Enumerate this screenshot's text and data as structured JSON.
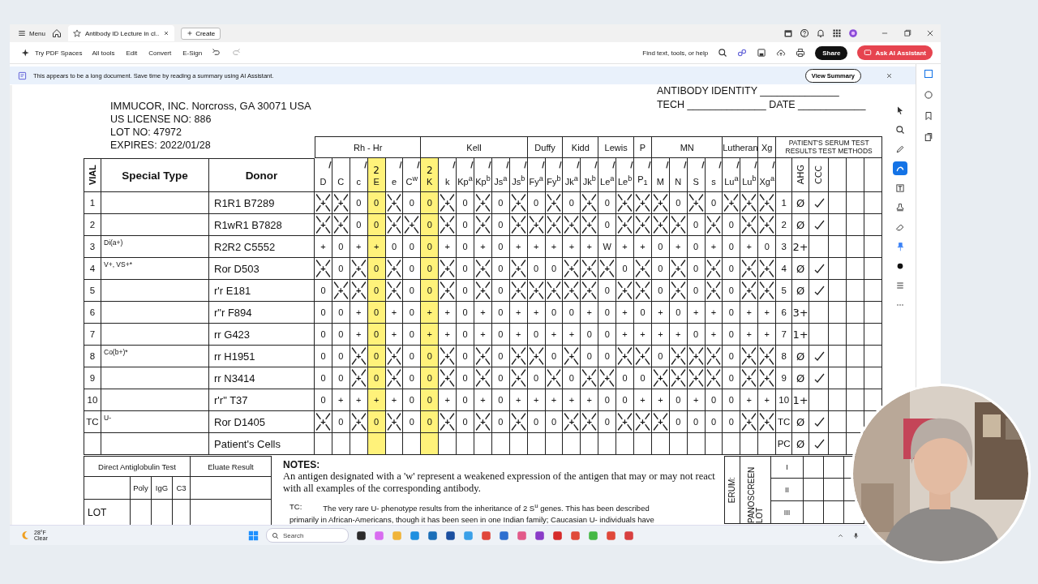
{
  "browser": {
    "menu": "Menu",
    "tabs": [
      {
        "title": "Antibody ID Lecture in cl..",
        "selected": true
      }
    ],
    "create": "Create"
  },
  "toolbar": {
    "spaces": "Try PDF Spaces",
    "menus": [
      "All tools",
      "Edit",
      "Convert",
      "E-Sign"
    ],
    "search": "Find text, tools, or help",
    "share": "Share",
    "ai": "Ask AI Assistant"
  },
  "banner": {
    "text": "This appears to be a long document. Save time by reading a summary using AI Assistant.",
    "button": "View Summary"
  },
  "tools": [
    {
      "kind": "select",
      "selected": false
    },
    {
      "kind": "zoom",
      "selected": false
    },
    {
      "kind": "pen",
      "selected": false
    },
    {
      "kind": "highlight",
      "selected": true
    },
    {
      "kind": "text",
      "selected": false
    },
    {
      "kind": "stamp",
      "selected": false
    },
    {
      "kind": "eraser",
      "selected": false
    },
    {
      "kind": "pin",
      "selected": false
    },
    {
      "kind": "color",
      "selected": false
    },
    {
      "kind": "lines",
      "selected": false
    },
    {
      "kind": "more",
      "selected": false
    }
  ],
  "document": {
    "company": [
      "IMMUCOR, INC. Norcross, GA 30071  USA",
      "US LICENSE NO:   886",
      "LOT NO:    47972",
      "EXPIRES: 2022/01/28"
    ],
    "identity": [
      "ANTIBODY IDENTITY ______________",
      "TECH ______________ DATE ____________"
    ],
    "panel": {
      "left_headers": [
        "VIAL",
        "Special Type",
        "Donor"
      ],
      "result_header": "PATIENT'S SERUM TEST RESULTS TEST METHODS",
      "methods": [
        "AHG",
        "CCC"
      ],
      "groups": [
        {
          "label": "Rh - Hr",
          "columns": [
            {
              "label": "D",
              "crossed": true,
              "highlighted": false
            },
            {
              "label": "C",
              "crossed": false,
              "highlighted": false
            },
            {
              "label": "c",
              "crossed": true,
              "highlighted": false
            },
            {
              "label": "E",
              "crossed": false,
              "highlighted": true,
              "note": "2"
            },
            {
              "label": "e",
              "crossed": true,
              "highlighted": false
            },
            {
              "label": "C$^{w}$",
              "crossed": true,
              "highlighted": false
            }
          ]
        },
        {
          "label": "Kell",
          "columns": [
            {
              "label": "K",
              "crossed": false,
              "highlighted": true,
              "note": "2"
            },
            {
              "label": "k",
              "crossed": true,
              "highlighted": false
            },
            {
              "label": "Kp$^{a}$",
              "crossed": true,
              "highlighted": false
            },
            {
              "label": "Kp$^{b}$",
              "crossed": true,
              "highlighted": false
            },
            {
              "label": "Js$^{a}$",
              "crossed": true,
              "highlighted": false
            },
            {
              "label": "Js$^{b}$",
              "crossed": true,
              "highlighted": false
            }
          ]
        },
        {
          "label": "Duffy",
          "columns": [
            {
              "label": "Fy$^{a}$",
              "crossed": true,
              "highlighted": false
            },
            {
              "label": "Fy$^{b}$",
              "crossed": true,
              "highlighted": false
            }
          ]
        },
        {
          "label": "Kidd",
          "columns": [
            {
              "label": "Jk$^{a}$",
              "crossed": true,
              "highlighted": false
            },
            {
              "label": "Jk$^{b}$",
              "crossed": true,
              "highlighted": false
            }
          ]
        },
        {
          "label": "Lewis",
          "columns": [
            {
              "label": "Le$^{a}$",
              "crossed": true,
              "highlighted": false
            },
            {
              "label": "Le$^{b}$",
              "crossed": true,
              "highlighted": false
            }
          ]
        },
        {
          "label": "P",
          "columns": [
            {
              "label": "P$_{1}$",
              "crossed": true,
              "highlighted": false
            }
          ]
        },
        {
          "label": "MN",
          "columns": [
            {
              "label": "M",
              "crossed": true,
              "highlighted": false
            },
            {
              "label": "N",
              "crossed": true,
              "highlighted": false
            },
            {
              "label": "S",
              "crossed": true,
              "highlighted": false
            },
            {
              "label": "s",
              "crossed": true,
              "highlighted": false
            }
          ]
        },
        {
          "label": "Lutheran",
          "columns": [
            {
              "label": "Lu$^{a}$",
              "crossed": true,
              "highlighted": false
            },
            {
              "label": "Lu$^{b}$",
              "crossed": true,
              "highlighted": false
            }
          ]
        },
        {
          "label": "Xg",
          "columns": [
            {
              "label": "Xg$^{a}$",
              "crossed": true,
              "highlighted": false
            }
          ]
        }
      ],
      "rows": [
        {
          "vial": "1",
          "donor": "R1R1 B7289",
          "values": [
            "+",
            "+",
            "0",
            "0",
            "+",
            "0",
            "0",
            "+",
            "0",
            "+",
            "0",
            "+",
            "0",
            "+",
            "0",
            "+",
            "0",
            "+",
            "+",
            "+",
            "0",
            "+",
            "0",
            "+",
            "+",
            "+"
          ],
          "crossed": [
            true,
            true,
            false,
            false,
            true,
            false,
            false,
            true,
            false,
            true,
            false,
            true,
            false,
            true,
            false,
            true,
            false,
            true,
            true,
            true,
            false,
            true,
            false,
            true,
            true,
            true
          ],
          "label": "1",
          "result": "Ø",
          "checked": true
        },
        {
          "vial": "2",
          "donor": "R1wR1 B7828",
          "values": [
            "+",
            "+",
            "0",
            "0",
            "+",
            "+",
            "0",
            "+",
            "0",
            "+",
            "0",
            "+",
            "+",
            "+",
            "+",
            "+",
            "0",
            "+",
            "+",
            "+",
            "+",
            "0",
            "+",
            "0",
            "+",
            "+"
          ],
          "crossed": [
            true,
            true,
            false,
            false,
            true,
            true,
            false,
            true,
            false,
            true,
            false,
            true,
            true,
            true,
            true,
            true,
            false,
            true,
            true,
            true,
            true,
            false,
            true,
            false,
            true,
            true
          ],
          "label": "2",
          "result": "Ø",
          "checked": true
        },
        {
          "vial": "3",
          "special": "Di(a+)",
          "donor": "R2R2 C5552",
          "values": [
            "+",
            "0",
            "+",
            "+",
            "0",
            "0",
            "0",
            "+",
            "0",
            "+",
            "0",
            "+",
            "+",
            "+",
            "+",
            "+",
            "W",
            "+",
            "+",
            "0",
            "+",
            "0",
            "+",
            "0",
            "+",
            "0"
          ],
          "crossed": [
            false,
            false,
            false,
            false,
            false,
            false,
            false,
            false,
            false,
            false,
            false,
            false,
            false,
            false,
            false,
            false,
            false,
            false,
            false,
            false,
            false,
            false,
            false,
            false,
            false,
            false
          ],
          "label": "3",
          "result": "2+",
          "checked": false
        },
        {
          "vial": "4",
          "special": "V+, VS+*",
          "donor": "Ror D503",
          "values": [
            "+",
            "0",
            "+",
            "0",
            "+",
            "0",
            "0",
            "+",
            "0",
            "+",
            "0",
            "+",
            "0",
            "0",
            "+",
            "+",
            "+",
            "0",
            "+",
            "0",
            "+",
            "0",
            "+",
            "0",
            "+",
            "+"
          ],
          "crossed": [
            true,
            false,
            true,
            false,
            true,
            false,
            false,
            true,
            false,
            true,
            false,
            true,
            false,
            false,
            true,
            true,
            true,
            false,
            true,
            false,
            true,
            false,
            true,
            false,
            true,
            true
          ],
          "label": "4",
          "result": "Ø",
          "checked": true
        },
        {
          "vial": "5",
          "donor": "r'r E181",
          "values": [
            "0",
            "+",
            "+",
            "0",
            "+",
            "0",
            "0",
            "+",
            "0",
            "+",
            "0",
            "+",
            "+",
            "+",
            "+",
            "+",
            "0",
            "+",
            "+",
            "0",
            "+",
            "0",
            "+",
            "0",
            "+",
            "+"
          ],
          "crossed": [
            false,
            true,
            true,
            false,
            true,
            false,
            false,
            true,
            false,
            true,
            false,
            true,
            true,
            true,
            true,
            true,
            false,
            true,
            true,
            false,
            true,
            false,
            true,
            false,
            true,
            true
          ],
          "label": "5",
          "result": "Ø",
          "checked": true
        },
        {
          "vial": "6",
          "donor": "r\"r F894",
          "values": [
            "0",
            "0",
            "+",
            "0",
            "+",
            "0",
            "+",
            "+",
            "0",
            "+",
            "0",
            "+",
            "+",
            "0",
            "0",
            "+",
            "0",
            "+",
            "0",
            "+",
            "0",
            "+",
            "+",
            "0",
            "+",
            "+"
          ],
          "crossed": [
            false,
            false,
            false,
            false,
            false,
            false,
            false,
            false,
            false,
            false,
            false,
            false,
            false,
            false,
            false,
            false,
            false,
            false,
            false,
            false,
            false,
            false,
            false,
            false,
            false,
            false
          ],
          "label": "6",
          "result": "3+",
          "checked": false
        },
        {
          "vial": "7",
          "donor": "rr G423",
          "values": [
            "0",
            "0",
            "+",
            "0",
            "+",
            "0",
            "+",
            "+",
            "0",
            "+",
            "0",
            "+",
            "0",
            "+",
            "+",
            "0",
            "0",
            "+",
            "+",
            "+",
            "+",
            "0",
            "+",
            "0",
            "+",
            "+"
          ],
          "crossed": [
            false,
            false,
            false,
            false,
            false,
            false,
            false,
            false,
            false,
            false,
            false,
            false,
            false,
            false,
            false,
            false,
            false,
            false,
            false,
            false,
            false,
            false,
            false,
            false,
            false,
            false
          ],
          "label": "7",
          "result": "1+",
          "checked": false
        },
        {
          "vial": "8",
          "special": "Co(b+)*",
          "donor": "rr H1951",
          "values": [
            "0",
            "0",
            "+",
            "0",
            "+",
            "0",
            "0",
            "+",
            "0",
            "+",
            "0",
            "+",
            "+",
            "0",
            "+",
            "0",
            "0",
            "+",
            "+",
            "0",
            "+",
            "+",
            "+",
            "0",
            "+",
            "+"
          ],
          "crossed": [
            false,
            false,
            true,
            false,
            true,
            false,
            false,
            true,
            false,
            true,
            false,
            true,
            true,
            false,
            true,
            false,
            false,
            true,
            true,
            false,
            true,
            true,
            true,
            false,
            true,
            true
          ],
          "label": "8",
          "result": "Ø",
          "checked": true
        },
        {
          "vial": "9",
          "donor": "rr N3414",
          "values": [
            "0",
            "0",
            "+",
            "0",
            "+",
            "0",
            "0",
            "+",
            "0",
            "+",
            "0",
            "+",
            "0",
            "+",
            "0",
            "+",
            "+",
            "0",
            "0",
            "+",
            "+",
            "+",
            "+",
            "0",
            "+",
            "+"
          ],
          "crossed": [
            false,
            false,
            true,
            false,
            true,
            false,
            false,
            true,
            false,
            true,
            false,
            true,
            false,
            true,
            false,
            true,
            true,
            false,
            false,
            true,
            true,
            true,
            true,
            false,
            true,
            true
          ],
          "label": "9",
          "result": "Ø",
          "checked": true
        },
        {
          "vial": "10",
          "donor": "r'r\" T37",
          "values": [
            "0",
            "+",
            "+",
            "+",
            "+",
            "0",
            "0",
            "+",
            "0",
            "+",
            "0",
            "+",
            "+",
            "+",
            "+",
            "+",
            "0",
            "0",
            "+",
            "+",
            "0",
            "+",
            "0",
            "0",
            "+",
            "+"
          ],
          "crossed": [
            false,
            false,
            false,
            false,
            false,
            false,
            false,
            false,
            false,
            false,
            false,
            false,
            false,
            false,
            false,
            false,
            false,
            false,
            false,
            false,
            false,
            false,
            false,
            false,
            false,
            false
          ],
          "label": "10",
          "result": "1+",
          "checked": false
        },
        {
          "vial": "TC",
          "special": "U-",
          "donor": "Ror D1405",
          "values": [
            "+",
            "0",
            "+",
            "0",
            "+",
            "0",
            "0",
            "+",
            "0",
            "+",
            "0",
            "+",
            "0",
            "0",
            "+",
            "+",
            "0",
            "+",
            "+",
            "+",
            "0",
            "0",
            "0",
            "0",
            "+",
            "+"
          ],
          "crossed": [
            true,
            false,
            true,
            false,
            true,
            false,
            false,
            true,
            false,
            true,
            false,
            true,
            false,
            false,
            true,
            true,
            false,
            true,
            true,
            true,
            false,
            false,
            false,
            false,
            true,
            true
          ],
          "label": "TC",
          "result": "Ø",
          "checked": true
        }
      ],
      "patient_row": {
        "donor": "Patient's Cells",
        "label": "PC",
        "result": "Ø",
        "checked": true
      }
    },
    "dat": {
      "title": "Direct Antiglobulin Test",
      "eluate": "Eluate Result",
      "columns": [
        "Poly",
        "IgG",
        "C3"
      ],
      "lot": "LOT"
    },
    "notes": {
      "title": "NOTES:",
      "text": "An antigen designated with a 'w' represent a weakened expression of the antigen that may or may not react with all examples of the corresponding antibody.",
      "tc_label": "TC:",
      "tc_text": "The very rare U- phenotype results from the inheritance of 2 S$^{u}$ genes.  This has been described",
      "tc_cut": "primarily in African-Americans, though it has been seen in one Indian family; Caucasian U- individuals have"
    },
    "screen": {
      "serum": "ERUM:",
      "panoscreen": "PANOSCREEN LOT",
      "cells": [
        "I",
        "II",
        "III"
      ]
    }
  },
  "taskbar": {
    "temperature": "28°F",
    "weather": "Clear",
    "search": "Search"
  }
}
